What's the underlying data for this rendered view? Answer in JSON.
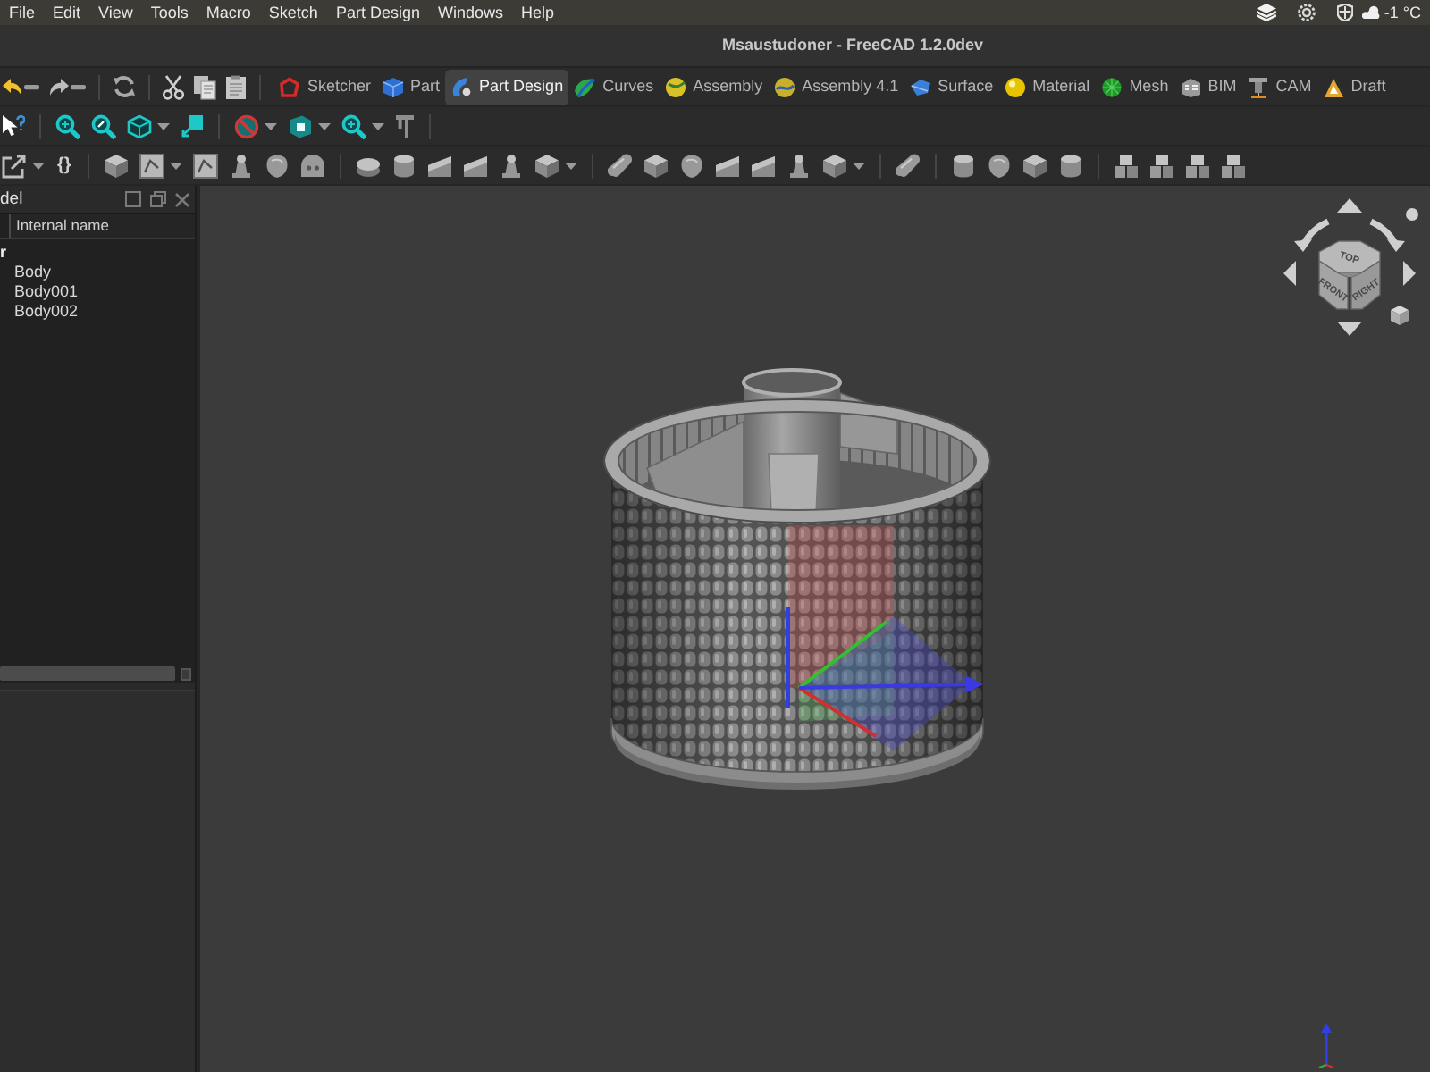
{
  "menu_bar": {
    "items": [
      "File",
      "Edit",
      "View",
      "Tools",
      "Macro",
      "Sketch",
      "Part Design",
      "Windows",
      "Help"
    ],
    "weather": "-1 °C"
  },
  "window": {
    "title": "Msaustudoner - FreeCAD 1.2.0dev"
  },
  "workbenches": [
    {
      "label": "Sketcher",
      "selected": false
    },
    {
      "label": "Part",
      "selected": false
    },
    {
      "label": "Part Design",
      "selected": true
    },
    {
      "label": "Curves",
      "selected": false
    },
    {
      "label": "Assembly",
      "selected": false
    },
    {
      "label": "Assembly 4.1",
      "selected": false
    },
    {
      "label": "Surface",
      "selected": false
    },
    {
      "label": "Material",
      "selected": false
    },
    {
      "label": "Mesh",
      "selected": false
    },
    {
      "label": "BIM",
      "selected": false
    },
    {
      "label": "CAM",
      "selected": false
    },
    {
      "label": "Draft",
      "selected": false
    }
  ],
  "toolbar_glyph": "{}",
  "model_panel": {
    "title": "del",
    "column": "Internal name",
    "tree": [
      {
        "label": "r",
        "children": [
          {
            "label": "Body"
          },
          {
            "label": "Body001"
          },
          {
            "label": "Body002"
          }
        ]
      }
    ]
  },
  "nav_cube": {
    "faces": [
      "TOP",
      "FRONT",
      "RIGHT"
    ]
  }
}
